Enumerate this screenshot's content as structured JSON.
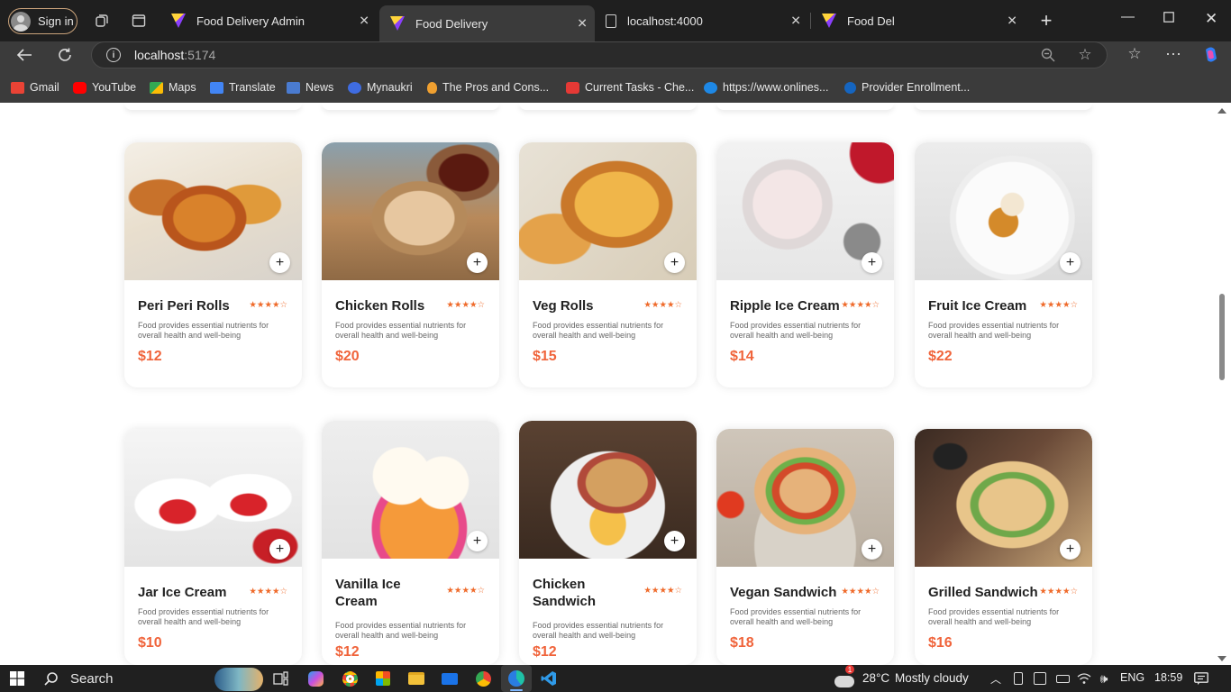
{
  "browser": {
    "signin_label": "Sign in",
    "tabs": [
      {
        "title": "Food Delivery Admin",
        "active": false
      },
      {
        "title": "Food Delivery",
        "active": true
      },
      {
        "title": "localhost:4000",
        "active": false
      },
      {
        "title": "Food Del",
        "active": false
      }
    ],
    "new_tab_icon": "plus-icon",
    "url_host": "localhost",
    "url_port": ":5174",
    "bookmarks": [
      {
        "label": "Gmail",
        "color": "#ea4335"
      },
      {
        "label": "YouTube",
        "color": "#ff0000"
      },
      {
        "label": "Maps",
        "color": "#34a853"
      },
      {
        "label": "Translate",
        "color": "#4285f4"
      },
      {
        "label": "News",
        "color": "#4a7bd0"
      },
      {
        "label": "Mynaukri",
        "color": "#3f6ce1"
      },
      {
        "label": "The Pros and Cons...",
        "color": "#f0a030"
      },
      {
        "label": "Current Tasks - Che...",
        "color": "#e53935"
      },
      {
        "label": "https://www.onlines...",
        "color": "#1e88e5"
      },
      {
        "label": "Provider Enrollment...",
        "color": "#1565c0"
      }
    ]
  },
  "menu": {
    "accent_color": "#f0643b",
    "star_rating": "★★★★☆",
    "items": [
      {
        "name": "Peri Peri Rolls",
        "desc": "Food provides essential nutrients for overall health and well-being",
        "price": "$12",
        "photo": "wrap"
      },
      {
        "name": "Chicken Rolls",
        "desc": "Food provides essential nutrients for overall health and well-being",
        "price": "$20",
        "photo": "roll"
      },
      {
        "name": "Veg Rolls",
        "desc": "Food provides essential nutrients for overall health and well-being",
        "price": "$15",
        "photo": "pastry"
      },
      {
        "name": "Ripple Ice Cream",
        "desc": "Food provides essential nutrients for overall health and well-being",
        "price": "$14",
        "photo": "icecream-bowl"
      },
      {
        "name": "Fruit Ice Cream",
        "desc": "Food provides essential nutrients for overall health and well-being",
        "price": "$22",
        "photo": "plate-dessert"
      },
      {
        "name": "Jar Ice Cream",
        "desc": "Food provides essential nutrients for overall health and well-being",
        "price": "$10",
        "photo": "jars"
      },
      {
        "name": "Vanilla Ice Cream",
        "desc": "Food provides essential nutrients for overall health and well-being",
        "price": "$12",
        "photo": "sprinkle-cone"
      },
      {
        "name": "Chicken Sandwich",
        "desc": "Food provides essential nutrients for overall health and well-being",
        "price": "$12",
        "photo": "sandwich-plate"
      },
      {
        "name": "Vegan Sandwich",
        "desc": "Food provides essential nutrients for overall health and well-being",
        "price": "$18",
        "photo": "sandwich-board"
      },
      {
        "name": "Grilled Sandwich",
        "desc": "Food provides essential nutrients for overall health and well-being",
        "price": "$16",
        "photo": "sandwich-paper"
      }
    ]
  },
  "taskbar": {
    "search_label": "Search",
    "weather_temp": "28°C",
    "weather_text": "Mostly cloudy",
    "weather_badge": "1",
    "language": "ENG",
    "time": "18:59"
  }
}
